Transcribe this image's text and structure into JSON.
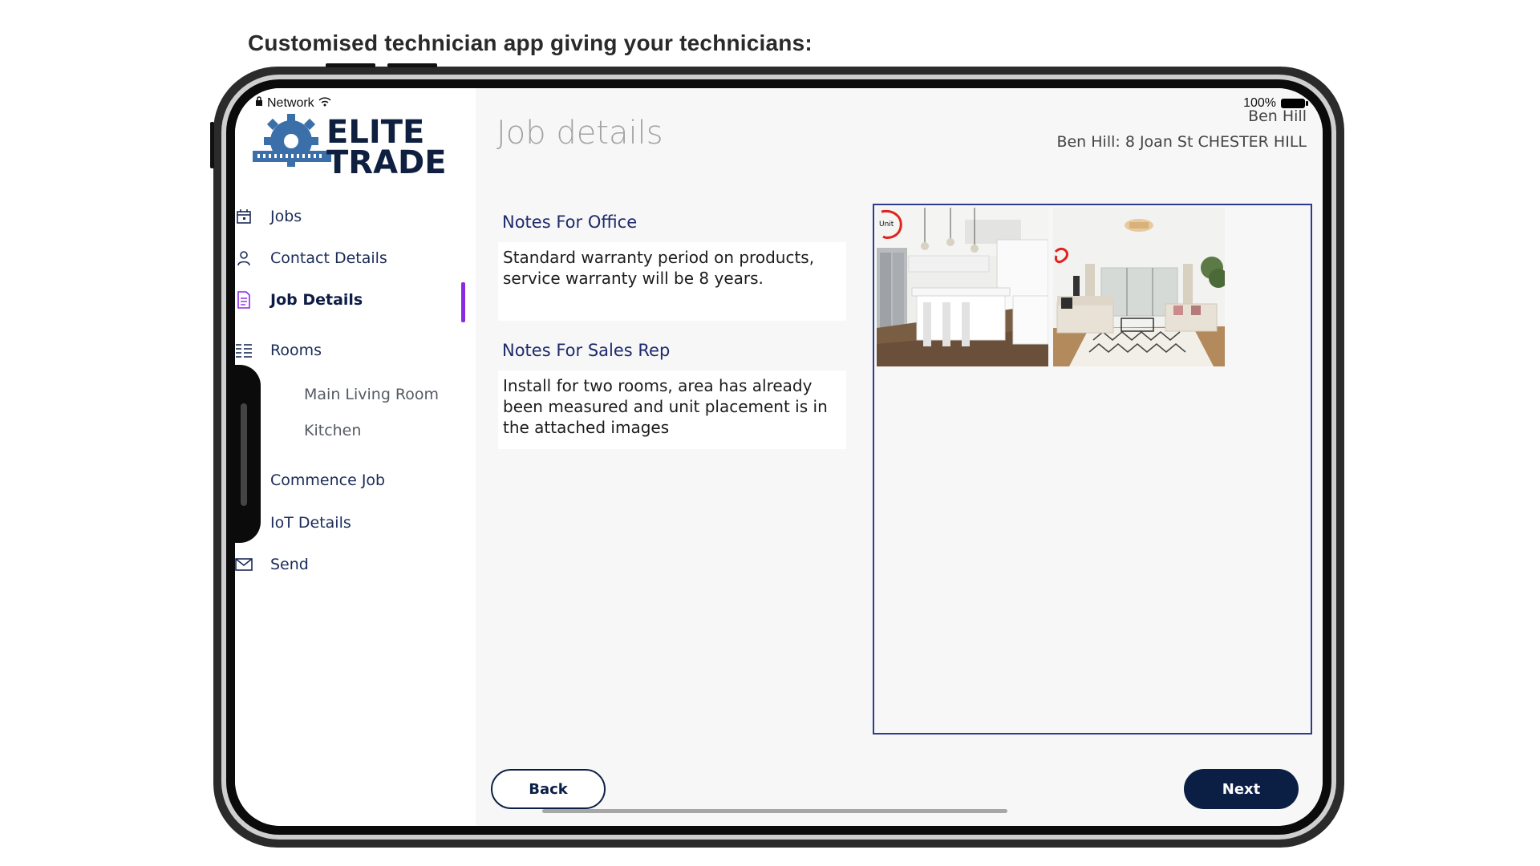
{
  "headline": "Customised technician app giving your technicians:",
  "status_bar": {
    "network": "Network",
    "battery": "100%"
  },
  "brand": {
    "line1": "ELITE",
    "line2": "TRADE"
  },
  "sidebar": {
    "items": [
      {
        "label": "Jobs",
        "icon": "calendar-icon"
      },
      {
        "label": "Contact Details",
        "icon": "person-icon"
      },
      {
        "label": "Job Details",
        "icon": "document-icon",
        "active": true
      },
      {
        "label": "Rooms",
        "icon": "list-icon"
      },
      {
        "label": "Commence Job",
        "icon": ""
      },
      {
        "label": "IoT Details",
        "icon": ""
      },
      {
        "label": "Send",
        "icon": "envelope-icon"
      }
    ],
    "rooms": [
      "Main Living Room",
      "Kitchen"
    ]
  },
  "main": {
    "title": "Job details",
    "user_name": "Ben Hill",
    "user_address": "Ben Hill: 8 Joan St CHESTER HILL",
    "notes_office": {
      "label": "Notes For Office",
      "text": "Standard warranty period on products, service warranty will be 8 years."
    },
    "notes_sales": {
      "label": "Notes For Sales Rep",
      "text": "Install for two rooms, area has already been measured and unit placement is in the attached images"
    },
    "photos": {
      "annotation": "Unit"
    }
  },
  "buttons": {
    "back": "Back",
    "next": "Next"
  },
  "colors": {
    "navy": "#0b1f45",
    "accent": "#8a2be2",
    "label": "#1e2a6b",
    "annotation": "#e0231d"
  }
}
